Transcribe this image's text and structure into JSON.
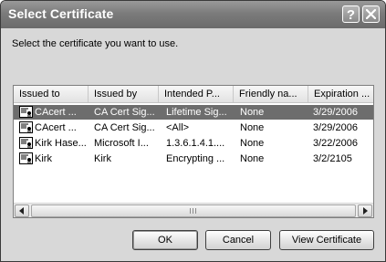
{
  "window": {
    "title": "Select Certificate",
    "help_glyph": "?",
    "prompt": "Select the certificate you want to use."
  },
  "list": {
    "columns": [
      "Issued to",
      "Issued by",
      "Intended P...",
      "Friendly na...",
      "Expiration ..."
    ],
    "rows": [
      {
        "issued_to": "CAcert ...",
        "issued_by": "CA Cert Sig...",
        "purpose": "Lifetime Sig...",
        "friendly": "None",
        "expiration": "3/29/2006",
        "selected": true
      },
      {
        "issued_to": "CAcert ...",
        "issued_by": "CA Cert Sig...",
        "purpose": "<All>",
        "friendly": "None",
        "expiration": "3/29/2006",
        "selected": false
      },
      {
        "issued_to": "Kirk Hase...",
        "issued_by": "Microsoft I...",
        "purpose": "1.3.6.1.4.1....",
        "friendly": "None",
        "expiration": "3/22/2006",
        "selected": false
      },
      {
        "issued_to": "Kirk",
        "issued_by": "Kirk",
        "purpose": "Encrypting ...",
        "friendly": "None",
        "expiration": "3/2/2105",
        "selected": false
      }
    ],
    "row_icon": "certificate-icon"
  },
  "buttons": {
    "ok": "OK",
    "cancel": "Cancel",
    "view": "View Certificate"
  },
  "colors": {
    "titlebar": "#7b7b7b",
    "selection": "#6d6d6d",
    "dialog_bg": "#d8d8d8"
  }
}
